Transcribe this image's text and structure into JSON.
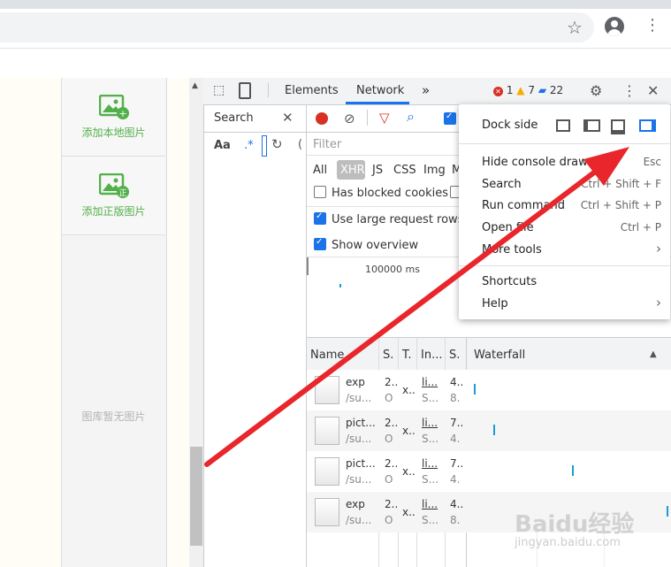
{
  "browser": {
    "star_icon": "star-icon",
    "profile_icon": "profile-icon",
    "menu_icon": "kebab-menu-icon"
  },
  "page": {
    "add_local_label": "添加本地图片",
    "add_licensed_label": "添加正版图片",
    "empty_text": "图库暂无图片"
  },
  "devtools": {
    "tabs": {
      "elements": "Elements",
      "network": "Network",
      "more": "»"
    },
    "errors": "1",
    "warnings": "7",
    "messages": "22",
    "search_tab": "Search",
    "aa": "Aa",
    "regex": ".*",
    "filter_placeholder": "Filter",
    "types": [
      "All",
      "XHR",
      "JS",
      "CSS",
      "Img",
      "M"
    ],
    "has_blocked": "Has blocked cookies",
    "large_rows": "Use large request rows",
    "overview": "Show overview",
    "timeline_tick": "100000 ms",
    "columns": {
      "name": "Name",
      "s": "S.",
      "t": "T.",
      "in": "In...",
      "s2": "S.",
      "waterfall": "Waterfall"
    },
    "rows": [
      {
        "name": "exp",
        "path": "/su...",
        "s1": "2..",
        "s2": "O",
        "t": "x..",
        "i1": "li...",
        "i2": "S...",
        "z1": "4..",
        "z2": "8."
      },
      {
        "name": "pict...",
        "path": "/su...",
        "s1": "2..",
        "s2": "O",
        "t": "x..",
        "i1": "li...",
        "i2": "S...",
        "z1": "7..",
        "z2": "4."
      },
      {
        "name": "pict...",
        "path": "/su...",
        "s1": "2..",
        "s2": "O",
        "t": "x..",
        "i1": "li...",
        "i2": "S...",
        "z1": "7..",
        "z2": "4."
      },
      {
        "name": "exp",
        "path": "/su...",
        "s1": "2..",
        "s2": "O",
        "t": "x..",
        "i1": "li...",
        "i2": "S...",
        "z1": "4..",
        "z2": "8."
      }
    ]
  },
  "menu": {
    "dock_side": "Dock side",
    "items": [
      {
        "label": "Hide console drawer",
        "key": "Esc"
      },
      {
        "label": "Search",
        "key": "Ctrl + Shift + F"
      },
      {
        "label": "Run command",
        "key": "Ctrl + Shift + P"
      },
      {
        "label": "Open file",
        "key": "Ctrl + P"
      },
      {
        "label": "More tools",
        "key": "›"
      }
    ],
    "shortcuts": "Shortcuts",
    "help": "Help",
    "help_arrow": "›"
  },
  "watermark": {
    "brand": "Baidu经验",
    "url": "jingyan.baidu.com"
  },
  "colors": {
    "annotation_arrow": "#e8262b",
    "accent": "#1a73e8",
    "green": "#52b04a"
  }
}
